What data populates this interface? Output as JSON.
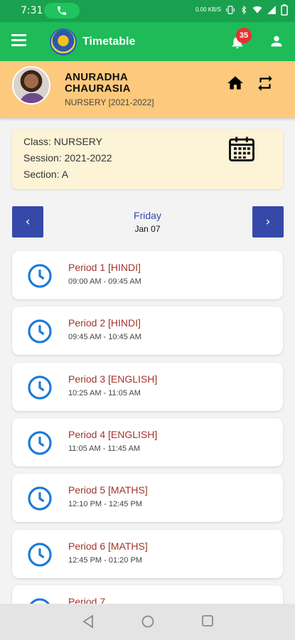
{
  "status_bar": {
    "time": "7:31",
    "network_speed": "0.00 KB/S",
    "battery_level": "B"
  },
  "app_bar": {
    "title": "Timetable",
    "notification_count": "35",
    "icons": [
      "menu-icon",
      "school-logo",
      "bell-icon",
      "user-icon"
    ]
  },
  "profile": {
    "name": "ANURADHA CHAURASIA",
    "class_session": "NURSERY [2021-2022]"
  },
  "info": {
    "class_line": "Class: NURSERY",
    "session_line": "Session: 2021-2022",
    "section_line": "Section: A"
  },
  "day_nav": {
    "prev_label": "‹",
    "next_label": "›",
    "day": "Friday",
    "date": "Jan 07"
  },
  "periods": [
    {
      "title": "Period 1 [HINDI]",
      "time": "09:00 AM - 09:45 AM"
    },
    {
      "title": "Period 2 [HINDI]",
      "time": "09:45 AM - 10:45 AM"
    },
    {
      "title": "Period 3 [ENGLISH]",
      "time": "10:25 AM - 11:05 AM"
    },
    {
      "title": "Period 4 [ENGLISH]",
      "time": "11:05 AM - 11:45 AM"
    },
    {
      "title": "Period 5 [MATHS]",
      "time": "12:10 PM - 12:45 PM"
    },
    {
      "title": "Period 6 [MATHS]",
      "time": "12:45 PM - 01:20 PM"
    },
    {
      "title": "Period 7",
      "time": ""
    }
  ],
  "colors": {
    "status_bar": "#1aa14f",
    "app_bar": "#1ebb58",
    "profile_bg": "#fdc97c",
    "info_bg": "#fdf3d6",
    "nav_button": "#3649a8",
    "period_title": "#a1342a",
    "clock": "#1a7ad9",
    "badge": "#e8312f"
  }
}
